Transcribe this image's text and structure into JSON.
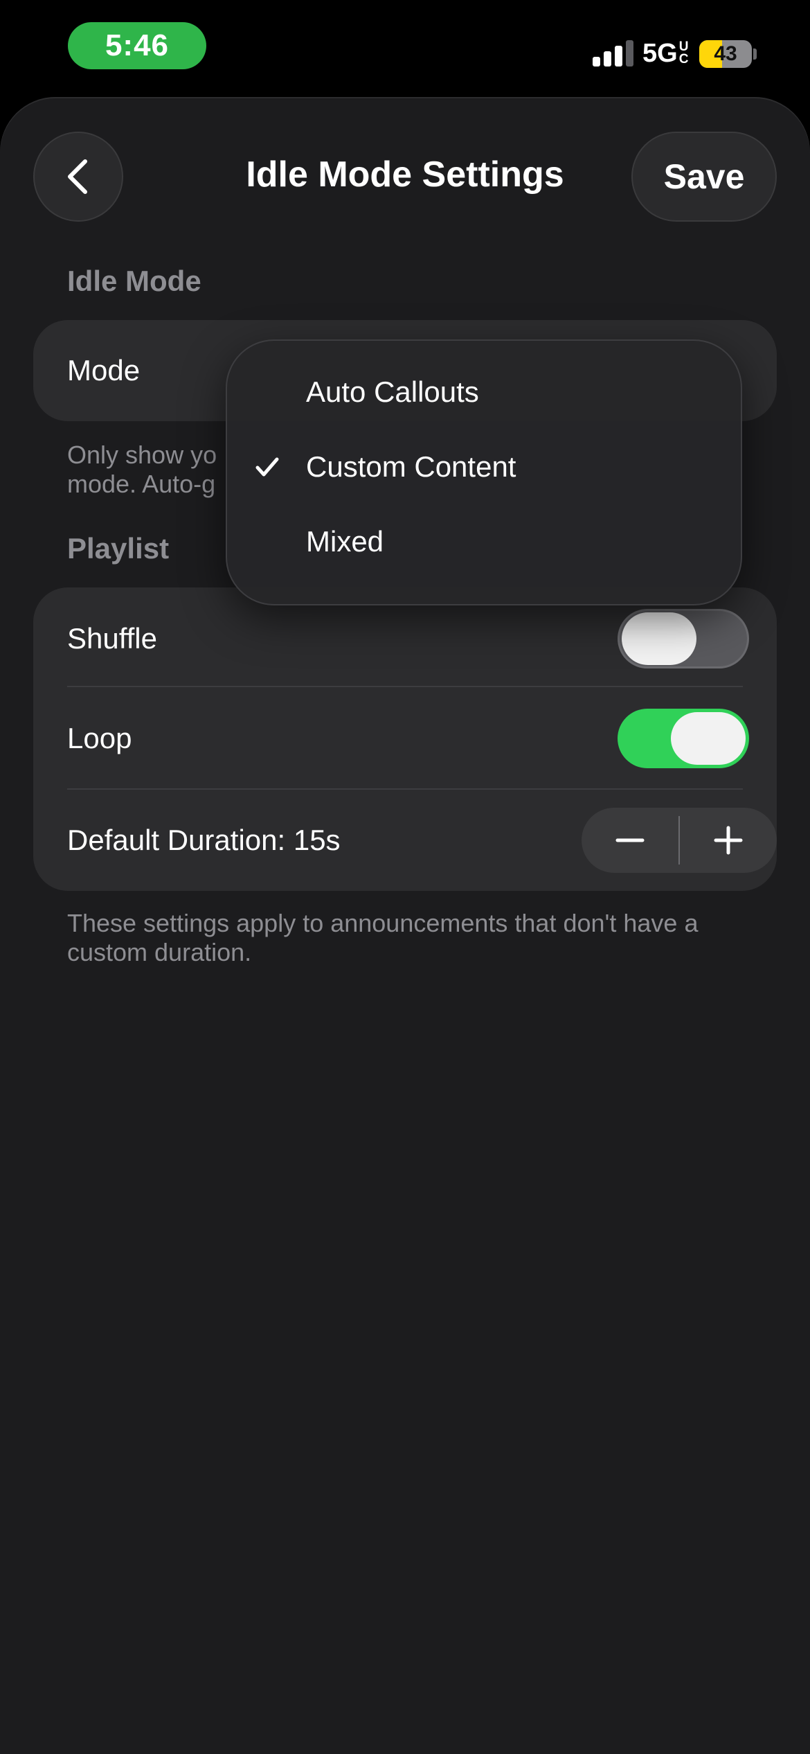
{
  "status_bar": {
    "time": "5:46",
    "network": "5G",
    "network_sup_1": "U",
    "network_sup_2": "C",
    "battery_level": "43",
    "battery_percent": 43,
    "signal_bars_active": 3
  },
  "nav": {
    "title": "Idle Mode Settings",
    "save_label": "Save",
    "back_icon": "chevron-left-icon"
  },
  "idle_mode": {
    "header": "Idle Mode",
    "mode_label": "Mode",
    "footnote_line1": "Only show yo",
    "footnote_line2": "mode. Auto-g"
  },
  "mode_menu": {
    "items": [
      {
        "label": "Auto Callouts",
        "selected": false
      },
      {
        "label": "Custom Content",
        "selected": true
      },
      {
        "label": "Mixed",
        "selected": false
      }
    ]
  },
  "playlist": {
    "header": "Playlist",
    "shuffle_label": "Shuffle",
    "shuffle_on": false,
    "loop_label": "Loop",
    "loop_on": true,
    "duration_label": "Default Duration: 15s",
    "footnote": "These settings apply to announcements that don't have a custom duration."
  },
  "colors": {
    "background": "#1c1c1e",
    "cell": "#2c2c2e",
    "toggle_on": "#30d158",
    "time_pill": "#2fb54a",
    "battery_fill": "#ffd60a",
    "secondary_text": "#8e8e93"
  }
}
